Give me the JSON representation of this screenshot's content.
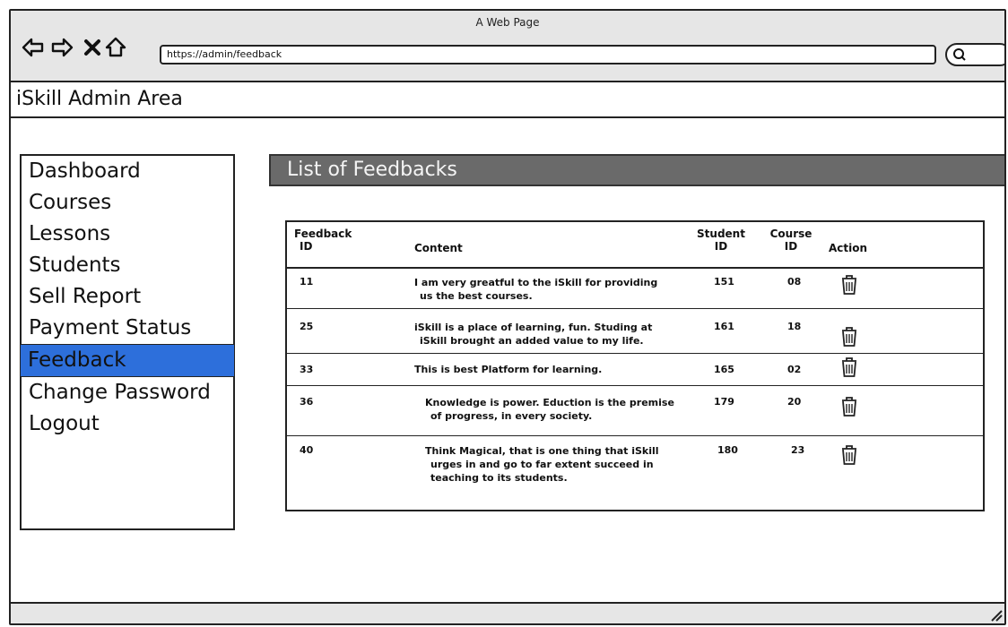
{
  "window": {
    "title": "A Web Page"
  },
  "browser": {
    "url": "https://admin/feedback",
    "icons": [
      "back-arrow-icon",
      "forward-arrow-icon",
      "close-icon",
      "home-icon",
      "search-icon"
    ]
  },
  "app": {
    "title": "iSkill Admin Area"
  },
  "sidebar": {
    "items": [
      {
        "label": "Dashboard"
      },
      {
        "label": "Courses"
      },
      {
        "label": "Lessons"
      },
      {
        "label": "Students"
      },
      {
        "label": "Sell Report"
      },
      {
        "label": "Payment Status"
      },
      {
        "label": "Feedback"
      },
      {
        "label": "Change Password"
      },
      {
        "label": "Logout"
      }
    ],
    "active": "Feedback"
  },
  "main": {
    "title": "List of Feedbacks",
    "table": {
      "headers": {
        "feedback_id_1": "Feedback",
        "feedback_id_2": "ID",
        "content": "Content",
        "student_id_1": "Student",
        "student_id_2": "ID",
        "course_id_1": "Course",
        "course_id_2": "ID",
        "action": "Action"
      },
      "rows": [
        {
          "id": "11",
          "content_1": "I am very greatful to the iSkill for providing",
          "content_2": "us the best courses.",
          "content_3": "",
          "student": "151",
          "course": "08"
        },
        {
          "id": "25",
          "content_1": "iSkill is a place of learning, fun. Studing at",
          "content_2": "iSkill brought an added value to my life.",
          "content_3": "",
          "student": "161",
          "course": "18"
        },
        {
          "id": "33",
          "content_1": "This is best Platform for learning.",
          "content_2": "",
          "content_3": "",
          "student": "165",
          "course": "02"
        },
        {
          "id": "36",
          "content_1": "Knowledge is power. Eduction is the premise",
          "content_2": "of progress, in every society.",
          "content_3": "",
          "student": "179",
          "course": "20"
        },
        {
          "id": "40",
          "content_1": "Think Magical, that is one thing that iSkill",
          "content_2": "urges in and go to far extent succeed in",
          "content_3": "teaching to its students.",
          "student": "180",
          "course": "23"
        }
      ]
    }
  }
}
